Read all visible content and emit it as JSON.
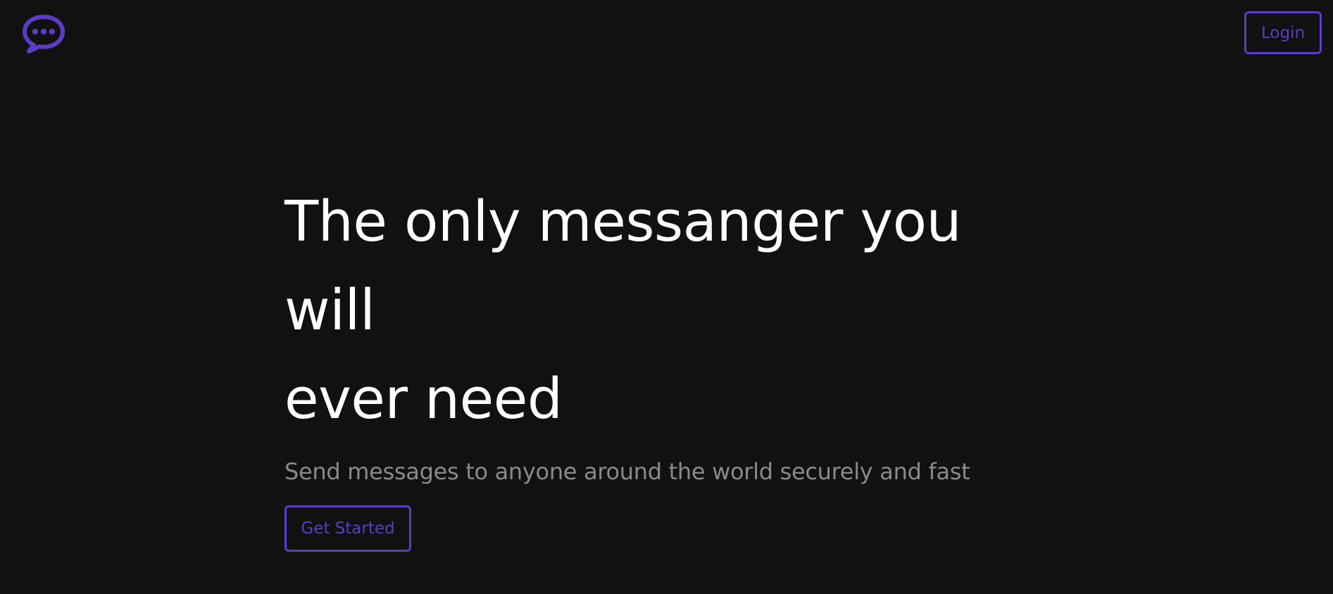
{
  "header": {
    "logo_icon": "chat-bubble-icon",
    "login_label": "Login"
  },
  "hero": {
    "title_line1": "The only messanger you will",
    "title_line2": "ever need",
    "subtitle": "Send messages to anyone around the world securely and fast",
    "cta_label": "Get Started"
  },
  "colors": {
    "background": "#111111",
    "accent": "#5b3cc4",
    "title": "#ffffff",
    "subtitle": "#8a8a8a"
  }
}
